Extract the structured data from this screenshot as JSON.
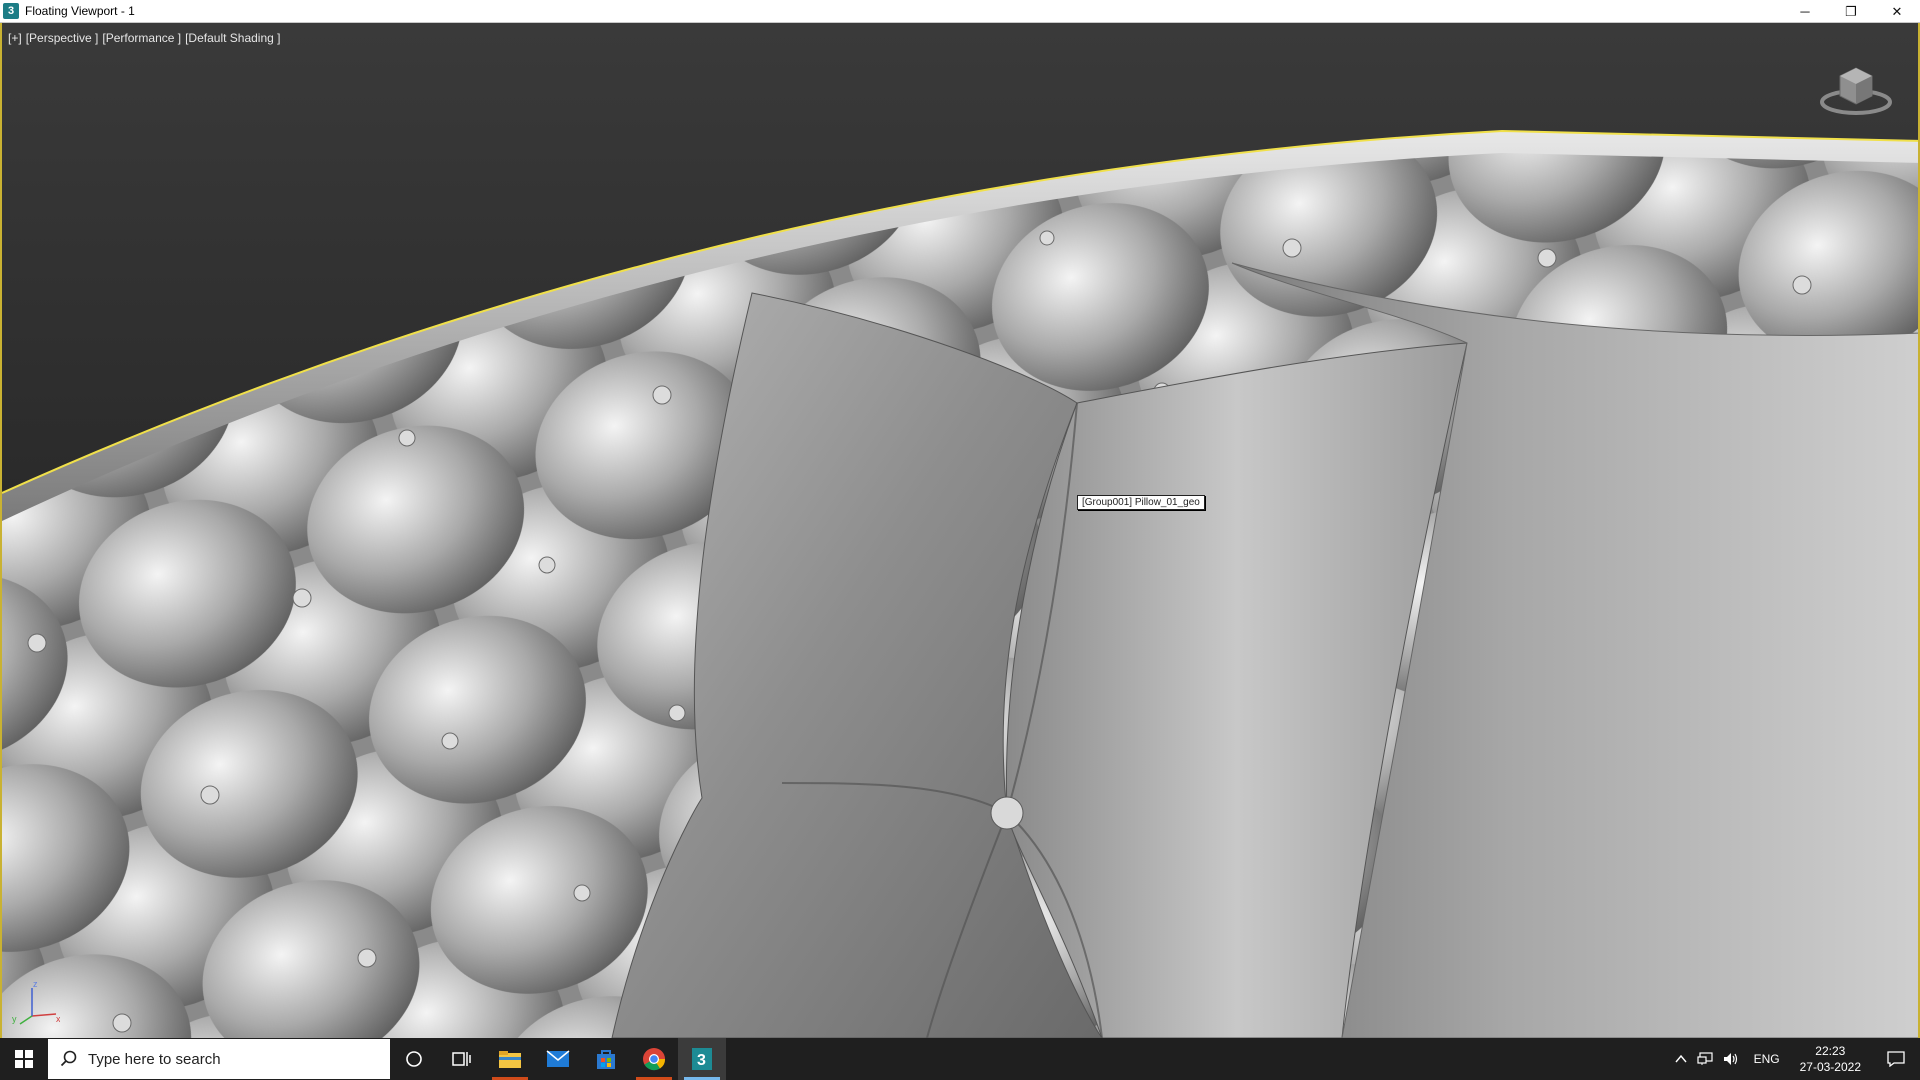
{
  "window": {
    "title": "Floating Viewport - 1",
    "app_icon_glyph": "3",
    "minimize_glyph": "─",
    "restore_glyph": "❐",
    "close_glyph": "✕"
  },
  "viewport": {
    "labels": [
      "[+]",
      "[Perspective ]",
      "[Performance ]",
      "[Default Shading ]"
    ],
    "hover_tooltip": "[Group001] Pillow_01_geo",
    "selection_color": "#f0e04a",
    "axis": {
      "x": "x",
      "y": "y",
      "z": "z"
    }
  },
  "taskbar": {
    "search_placeholder": "Type here to search",
    "apps": [
      {
        "icon": "cortana-icon"
      },
      {
        "icon": "task-view-icon"
      },
      {
        "icon": "file-explorer-icon"
      },
      {
        "icon": "mail-icon"
      },
      {
        "icon": "store-icon"
      },
      {
        "icon": "chrome-icon"
      },
      {
        "icon": "3dsmax-icon"
      }
    ],
    "tray": {
      "language": "ENG",
      "time": "22:23",
      "date": "27-03-2022"
    }
  }
}
